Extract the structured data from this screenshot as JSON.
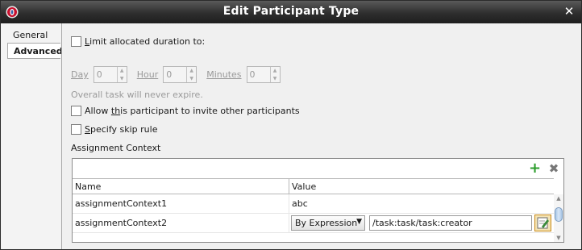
{
  "window": {
    "title": "Edit Participant Type",
    "close_glyph": "✕"
  },
  "tabs": [
    {
      "label": "General",
      "selected": false
    },
    {
      "label": "Advanced:",
      "selected": true
    }
  ],
  "limit_duration": {
    "label": "Limit allocated duration to:",
    "mnemonic": "L",
    "checked": false
  },
  "duration": {
    "day": {
      "label": "Day",
      "value": "0"
    },
    "hour": {
      "label": "Hour",
      "value": "0"
    },
    "minutes": {
      "label": "Minutes",
      "value": "0"
    }
  },
  "expire_note": "Overall task will never expire.",
  "allow_invite": {
    "label_prefix": "Allow ",
    "mnemonic": "th",
    "label_suffix": "is participant to invite other participants",
    "checked": false
  },
  "skip_rule": {
    "label": "Specify skip rule",
    "mnemonic": "S",
    "checked": false
  },
  "assignment_context": {
    "heading": "Assignment Context",
    "columns": [
      "Name",
      "Value"
    ],
    "rows": [
      {
        "name": "assignmentContext1",
        "value": "abc"
      },
      {
        "name": "assignmentContext2",
        "mode": "By Expression",
        "expression": "/task:task/task:creator"
      }
    ]
  },
  "icons": {
    "logo": "oracle-logo-icon",
    "add": "add-icon",
    "delete": "delete-icon",
    "edit": "edit-expression-icon"
  },
  "colors": {
    "titlebar": "#2e2e2e",
    "add_green": "#2c9d2c",
    "selection_blue": "#a8c6e6"
  }
}
